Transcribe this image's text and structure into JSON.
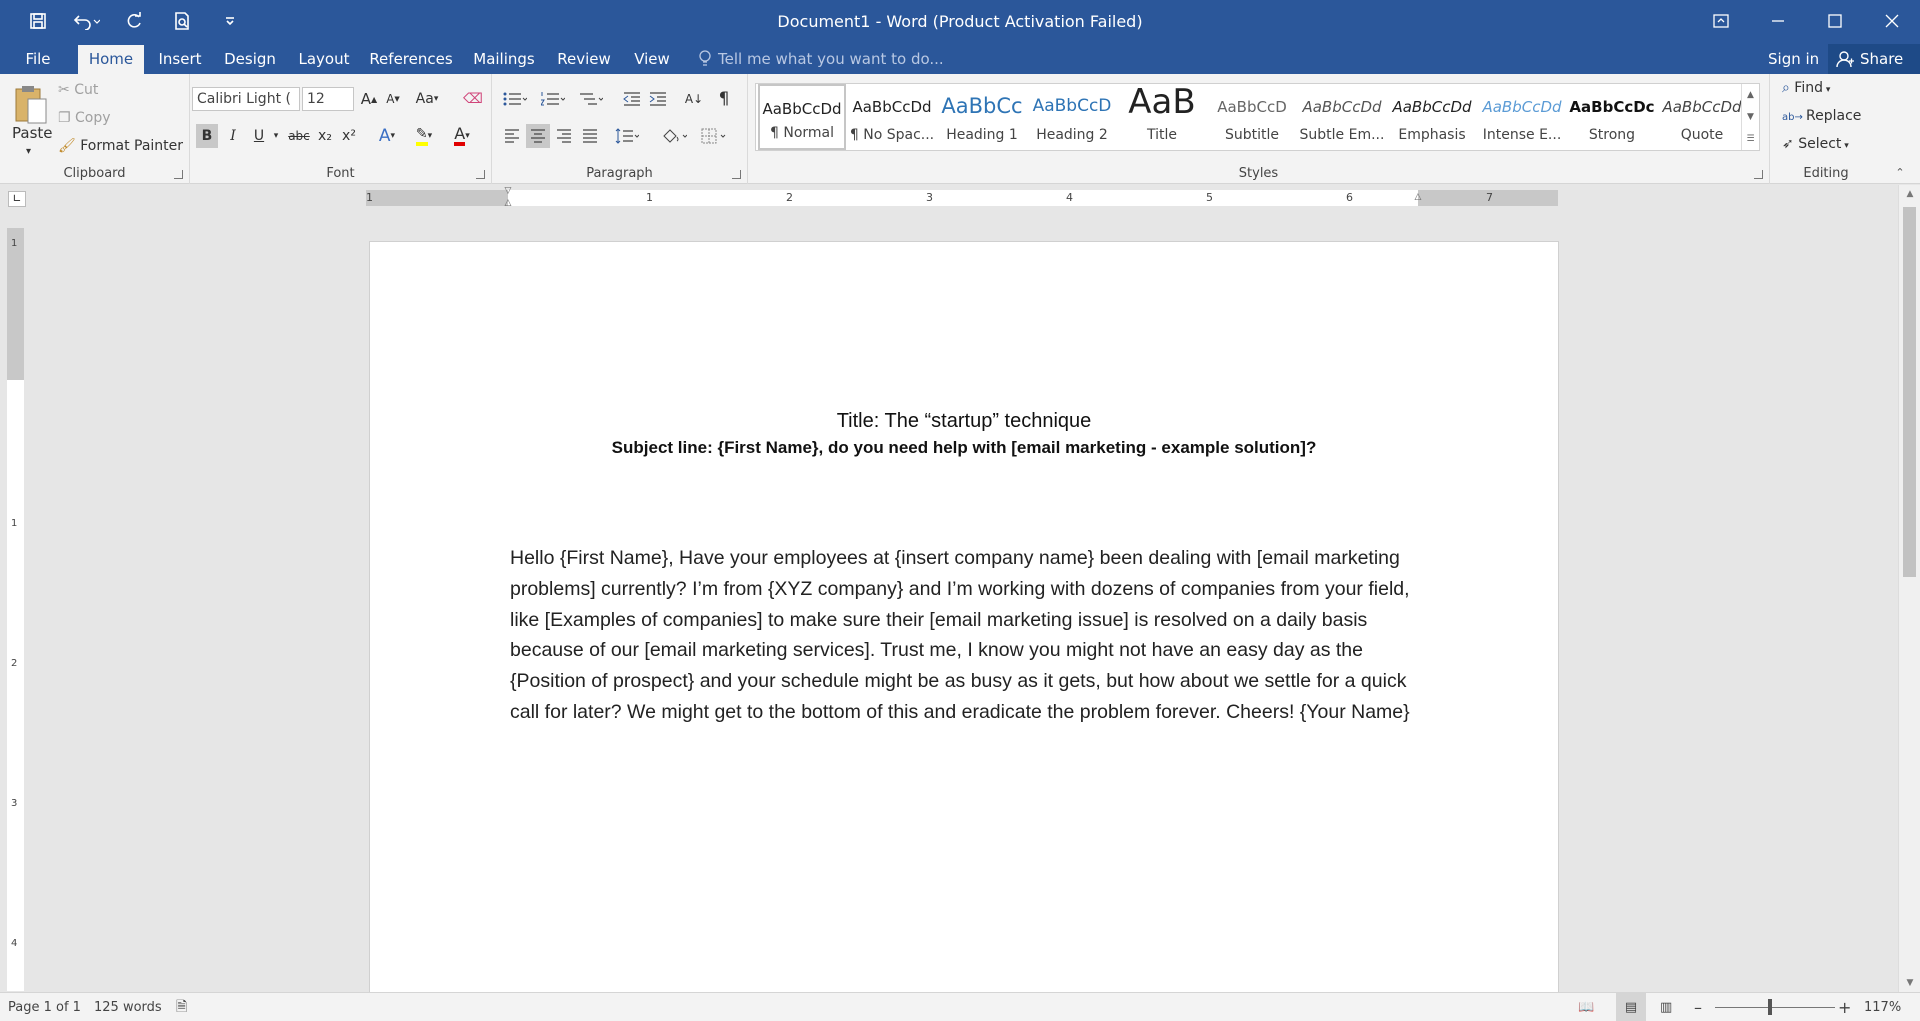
{
  "window": {
    "title": "Document1 - Word (Product Activation Failed)"
  },
  "tabs": {
    "file": "File",
    "home": "Home",
    "insert": "Insert",
    "design": "Design",
    "layout": "Layout",
    "references": "References",
    "mailings": "Mailings",
    "review": "Review",
    "view": "View"
  },
  "tell_me": {
    "placeholder": "Tell me what you want to do..."
  },
  "account": {
    "sign_in": "Sign in",
    "share": "Share"
  },
  "clipboard": {
    "paste": "Paste",
    "cut": "Cut",
    "copy": "Copy",
    "format_painter": "Format Painter",
    "label": "Clipboard"
  },
  "font": {
    "family": "Calibri Light (",
    "size": "12",
    "change_case": "Aa",
    "label": "Font",
    "bold": "B",
    "italic": "I",
    "underline": "U",
    "strike": "abc",
    "subscript": "x₂",
    "superscript": "x²",
    "grow": "A",
    "shrink": "A",
    "text_effects": "A",
    "font_color": "A"
  },
  "paragraph": {
    "label": "Paragraph",
    "show_marks": "¶",
    "sort": "A↓"
  },
  "styles": {
    "label": "Styles",
    "items": [
      {
        "preview": "AaBbCcDd",
        "name": "¶ Normal"
      },
      {
        "preview": "AaBbCcDd",
        "name": "¶ No Spac..."
      },
      {
        "preview": "AaBbCc",
        "name": "Heading 1"
      },
      {
        "preview": "AaBbCcD",
        "name": "Heading 2"
      },
      {
        "preview": "AaB",
        "name": "Title"
      },
      {
        "preview": "AaBbCcD",
        "name": "Subtitle"
      },
      {
        "preview": "AaBbCcDd",
        "name": "Subtle Em..."
      },
      {
        "preview": "AaBbCcDd",
        "name": "Emphasis"
      },
      {
        "preview": "AaBbCcDd",
        "name": "Intense E..."
      },
      {
        "preview": "AaBbCcDc",
        "name": "Strong"
      },
      {
        "preview": "AaBbCcDd",
        "name": "Quote"
      }
    ]
  },
  "editing": {
    "label": "Editing",
    "find": "Find",
    "replace": "Replace",
    "select": "Select"
  },
  "ruler": {
    "h_numbers": [
      "1",
      "1",
      "2",
      "3",
      "4",
      "5",
      "6",
      "7"
    ],
    "v_numbers": [
      "1",
      "1",
      "2",
      "3",
      "4"
    ]
  },
  "document": {
    "title": "Title: The “startup” technique",
    "subject": "Subject line: {First Name}, do you need help with [email marketing - example solution]?",
    "body": "Hello {First Name}, Have your employees at {insert company name} been dealing with [email marketing problems] currently? I’m from {XYZ company} and I’m working with dozens of companies from your field, like [Examples of companies] to make sure their [email marketing issue] is resolved on a daily basis because of our [email marketing services]. Trust me, I know you might not have an easy day as the {Position of prospect} and your schedule might be as busy as it gets, but how about we settle for a quick call for later? We might get to the bottom of this and eradicate the problem forever. Cheers! {Your Name}"
  },
  "status": {
    "page": "Page 1 of 1",
    "words": "125 words",
    "zoom_minus": "–",
    "zoom_plus": "+",
    "zoom": "117%"
  },
  "colors": {
    "accent": "#2b579a",
    "highlight": "#ffff00",
    "font_color": "#e00000"
  }
}
